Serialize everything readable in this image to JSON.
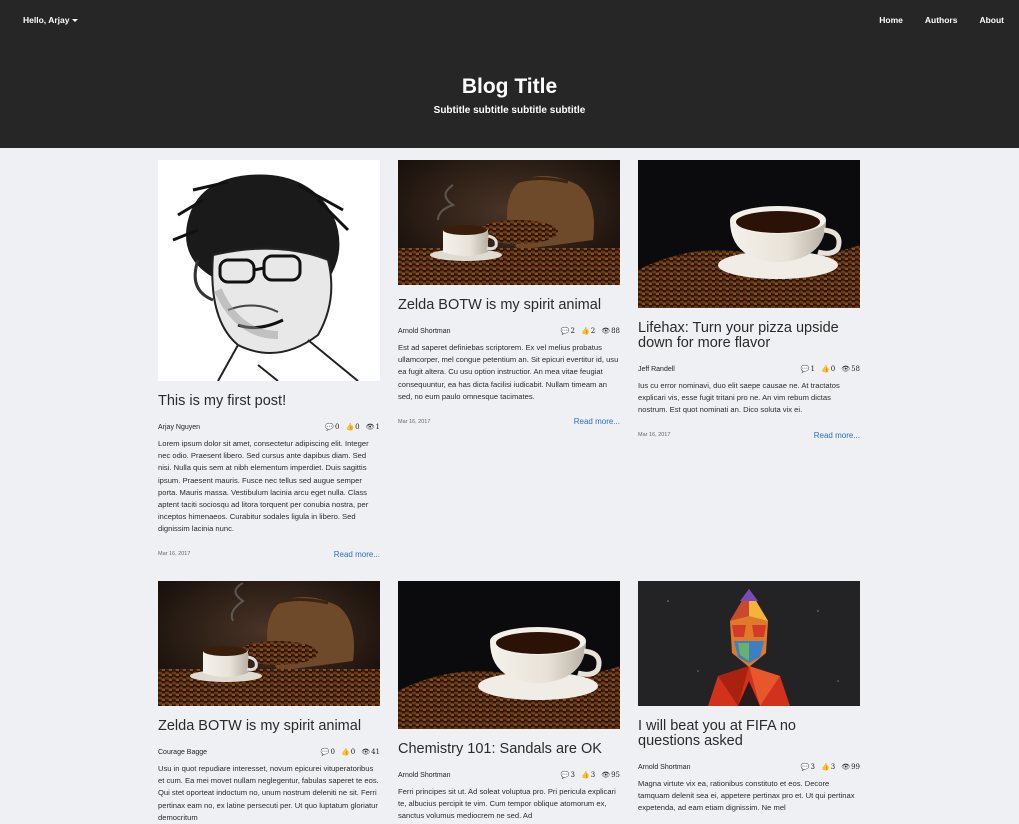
{
  "header": {
    "user_greeting": "Hello, Arjay",
    "nav": [
      "Home",
      "Authors",
      "About"
    ],
    "title": "Blog Title",
    "subtitle": "Subtitle subtitle subtitle subtitle"
  },
  "posts": [
    {
      "title": "This is my first post!",
      "author": "Arjay Nguyen",
      "comments": "0",
      "likes": "0",
      "views": "1",
      "excerpt": "Lorem ipsum dolor sit amet, consectetur adipiscing elit. Integer nec odio. Praesent libero. Sed cursus ante dapibus diam. Sed nisi. Nulla quis sem at nibh elementum imperdiet. Duis sagittis ipsum. Praesent mauris. Fusce nec tellus sed augue semper porta. Mauris massa. Vestibulum lacinia arcu eget nulla. Class aptent taciti sociosqu ad litora torquent per conubia nostra, per inceptos himenaeos. Curabitur sodales ligula in libero. Sed dignissim lacinia nunc.",
      "date": "Mar 16, 2017",
      "read_more": "Read more...",
      "image": "sketch-portrait"
    },
    {
      "title": "Zelda BOTW is my spirit animal",
      "author": "Arnold Shortman",
      "comments": "2",
      "likes": "2",
      "views": "88",
      "excerpt": "Est ad saperet definiebas scriptorem. Ex vel melius probatus ullamcorper, mel congue petentium an. Sit epicuri evertitur id, usu ea fugit altera. Cu usu option instructior. An mea vitae feugiat consequuntur, ea has dicta facilisi iudicabit. Nullam timeam an sed, no eum paulo omnesque tacimates.",
      "date": "Mar 16, 2017",
      "read_more": "Read more...",
      "image": "coffee-sack"
    },
    {
      "title": "Lifehax: Turn your pizza upside down for more flavor",
      "author": "Jeff Randell",
      "comments": "1",
      "likes": "0",
      "views": "58",
      "excerpt": "Ius cu error nominavi, duo elit saepe causae ne. At tractatos explicari vis, esse fugit tritani pro ne. An vim rebum dictas nostrum. Est quot nominati an. Dico soluta vix ei.",
      "date": "Mar 16, 2017",
      "read_more": "Read more...",
      "image": "coffee-cup"
    },
    {
      "title": "Zelda BOTW is my spirit animal",
      "author": "Courage Bagge",
      "comments": "0",
      "likes": "0",
      "views": "41",
      "excerpt": "Usu in quot repudiare interesset, novum epicurei vituperatoribus et cum. Ea mei movet nullam neglegentur, fabulas saperet te eos. Qui stet oporteat indoctum no, unum nostrum deleniti ne sit. Ferri pertinax eam no, ex latine persecuti per. Ut quo luptatum gloriatur democritum",
      "image": "coffee-sack"
    },
    {
      "title": "Chemistry 101: Sandals are OK",
      "author": "Arnold Shortman",
      "comments": "3",
      "likes": "3",
      "views": "95",
      "excerpt": "Ferri principes sit ut. Ad soleat voluptua pro. Pri pericula explicari te, albucius percipit te vim. Cum tempor oblique atomorum ex, sanctus volumus mediocrem ne sed. Ad",
      "image": "coffee-cup"
    },
    {
      "title": "I will beat you at FIFA no questions asked",
      "author": "Arnold Shortman",
      "comments": "3",
      "likes": "3",
      "views": "99",
      "excerpt": "Magna virtute vix ea, rationibus constituto et eos. Decore tamquam delenit sea ei, appetere pertinax pro et. Ut qui pertinax expetenda, ad eam etiam dignissim. Ne mel",
      "image": "polygon-starlord"
    }
  ]
}
